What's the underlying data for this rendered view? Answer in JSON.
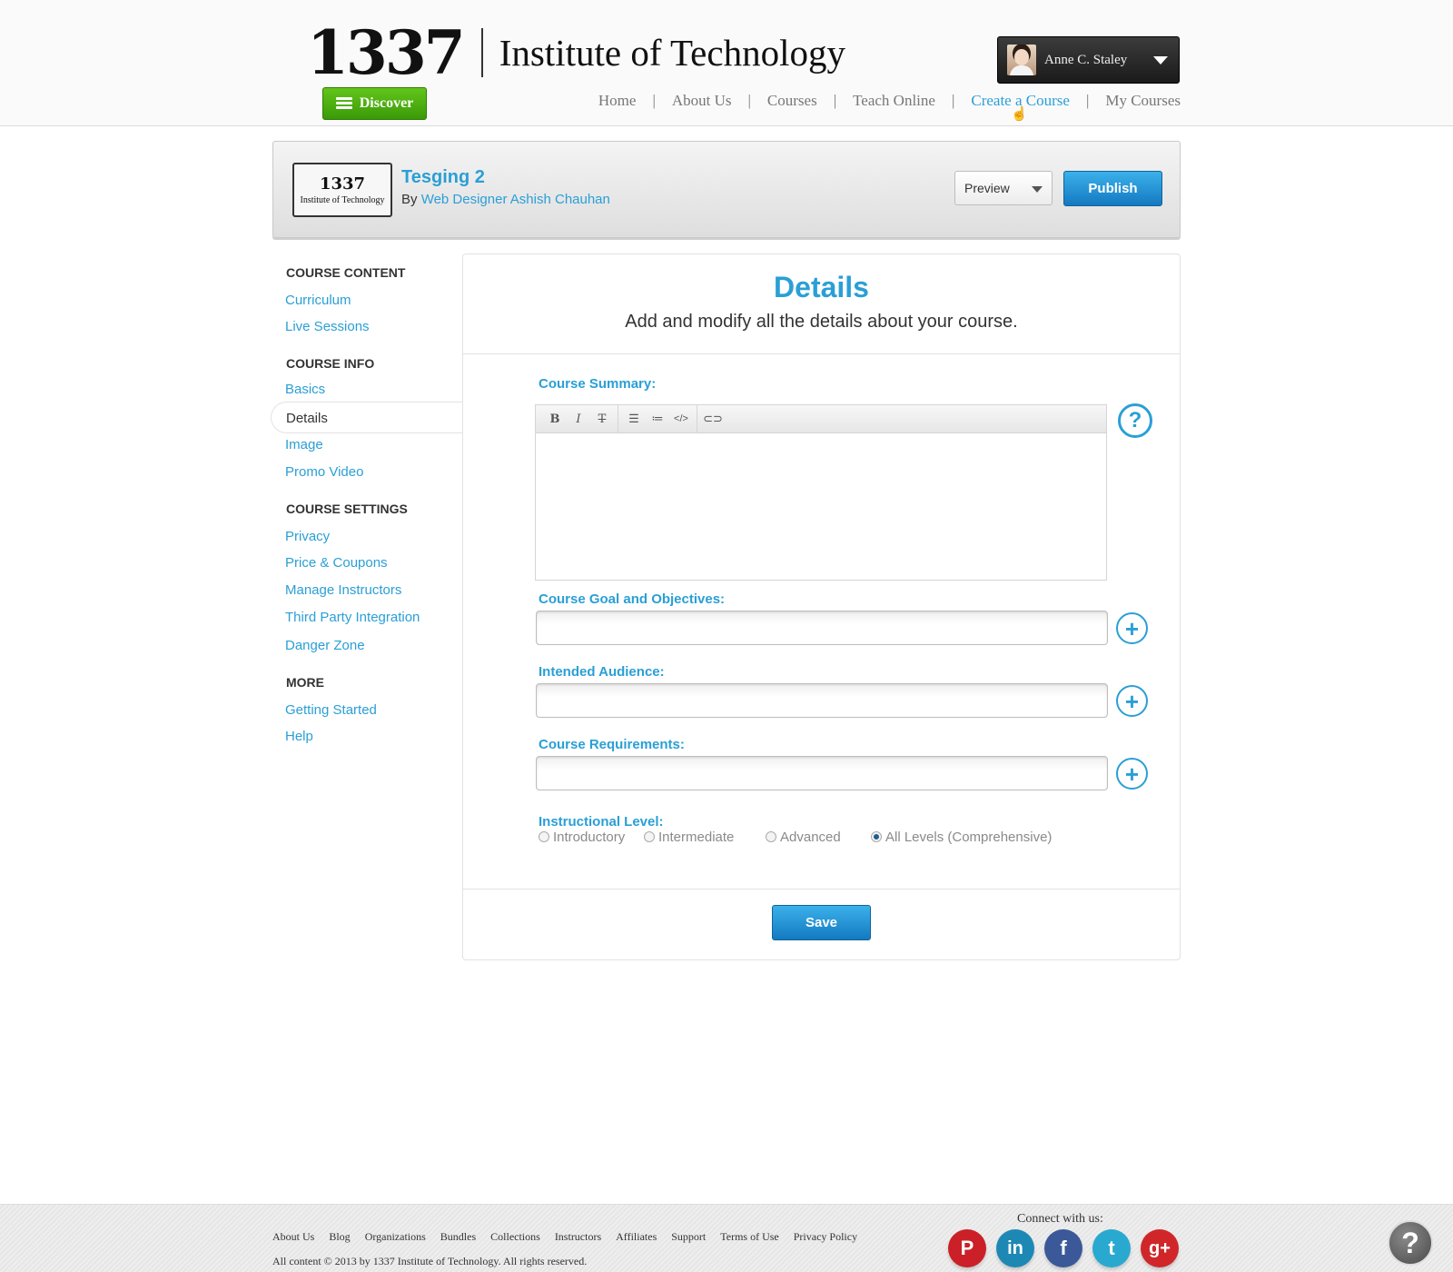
{
  "header": {
    "logo_number": "1337",
    "logo_name": "Institute of Technology",
    "discover_label": "Discover",
    "user_name": "Anne C. Staley",
    "nav": [
      "Home",
      "About Us",
      "Courses",
      "Teach Online",
      "Create a Course",
      "My Courses"
    ],
    "nav_separator": "|",
    "active_nav": "Create a Course"
  },
  "course": {
    "thumb_number": "1337",
    "thumb_name": "Institute of Technology",
    "title": "Tesging 2",
    "by_prefix": "By",
    "author": "Web Designer Ashish Chauhan",
    "preview_label": "Preview",
    "publish_label": "Publish"
  },
  "sidebar": {
    "sections": [
      {
        "heading": "COURSE CONTENT",
        "items": [
          "Curriculum",
          "Live Sessions"
        ]
      },
      {
        "heading": "COURSE INFO",
        "items": [
          "Basics",
          "Details",
          "Image",
          "Promo Video"
        ]
      },
      {
        "heading": "COURSE SETTINGS",
        "items": [
          "Privacy",
          "Price & Coupons",
          "Manage Instructors",
          "Third Party Integration",
          "Danger Zone"
        ]
      },
      {
        "heading": "MORE",
        "items": [
          "Getting Started",
          "Help"
        ]
      }
    ],
    "active_item": "Details"
  },
  "main": {
    "title": "Details",
    "subtitle": "Add and modify all the details about your course.",
    "summary_label": "Course Summary:",
    "summary_value": "",
    "editor_toolbar": {
      "bold": "B",
      "italic": "I",
      "strike": "T",
      "code": "</>"
    },
    "help_symbol": "?",
    "plus_symbol": "+",
    "goal_label": "Course Goal and Objectives:",
    "goal_value": "",
    "audience_label": "Intended Audience:",
    "audience_value": "",
    "requirements_label": "Course Requirements:",
    "requirements_value": "",
    "level_label": "Instructional Level:",
    "levels": [
      "Introductory",
      "Intermediate",
      "Advanced",
      "All Levels (Comprehensive)"
    ],
    "selected_level": "All Levels (Comprehensive)",
    "save_label": "Save"
  },
  "footer": {
    "links": [
      "About Us",
      "Blog",
      "Organizations",
      "Bundles",
      "Collections",
      "Instructors",
      "Affiliates",
      "Support",
      "Terms of Use",
      "Privacy Policy"
    ],
    "copyright": "All content © 2013 by 1337 Institute of Technology. All rights reserved.",
    "connect_label": "Connect with us:",
    "social": [
      {
        "name": "pinterest-icon",
        "glyph": "P",
        "color": "#cb2027"
      },
      {
        "name": "linkedin-icon",
        "glyph": "in",
        "color": "#1e88b4"
      },
      {
        "name": "facebook-icon",
        "glyph": "f",
        "color": "#3b5998"
      },
      {
        "name": "twitter-icon",
        "glyph": "t",
        "color": "#2aa9d0"
      },
      {
        "name": "google-plus-icon",
        "glyph": "g+",
        "color": "#d0262a"
      }
    ],
    "help_symbol": "?"
  },
  "colors": {
    "accent": "#2a9fd6",
    "discover_green": "#4bb010",
    "publish_blue": "#1a8ad0"
  }
}
